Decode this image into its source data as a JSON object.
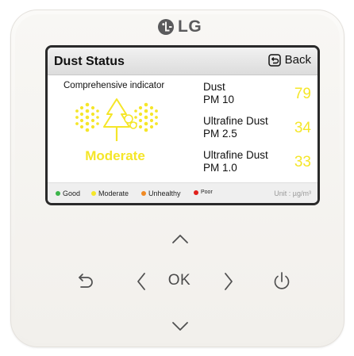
{
  "brand": {
    "name": "LG"
  },
  "screen": {
    "title": "Dust Status",
    "back_label": "Back",
    "comprehensive_label": "Comprehensive indicator",
    "level": "Moderate",
    "level_color": "#f5e629",
    "metrics": [
      {
        "name_line1": "Dust",
        "name_line2": "PM 10",
        "value": "79"
      },
      {
        "name_line1": "Ultrafine Dust",
        "name_line2": "PM 2.5",
        "value": "34"
      },
      {
        "name_line1": "Ultrafine Dust",
        "name_line2": "PM 1.0",
        "value": "33"
      }
    ],
    "legend": [
      {
        "label": "Good",
        "color": "#3bb54a"
      },
      {
        "label": "Moderate",
        "color": "#f5e629"
      },
      {
        "label": "Unhealthy",
        "color": "#f08a24"
      },
      {
        "label": "Poor",
        "color": "#e0201b"
      }
    ],
    "unit": "Unit : µg/m³"
  },
  "keypad": {
    "ok_label": "OK",
    "icons": [
      "chevron-up-icon",
      "chevron-left-icon",
      "chevron-right-icon",
      "chevron-down-icon",
      "back-arrow-icon",
      "power-icon"
    ]
  }
}
